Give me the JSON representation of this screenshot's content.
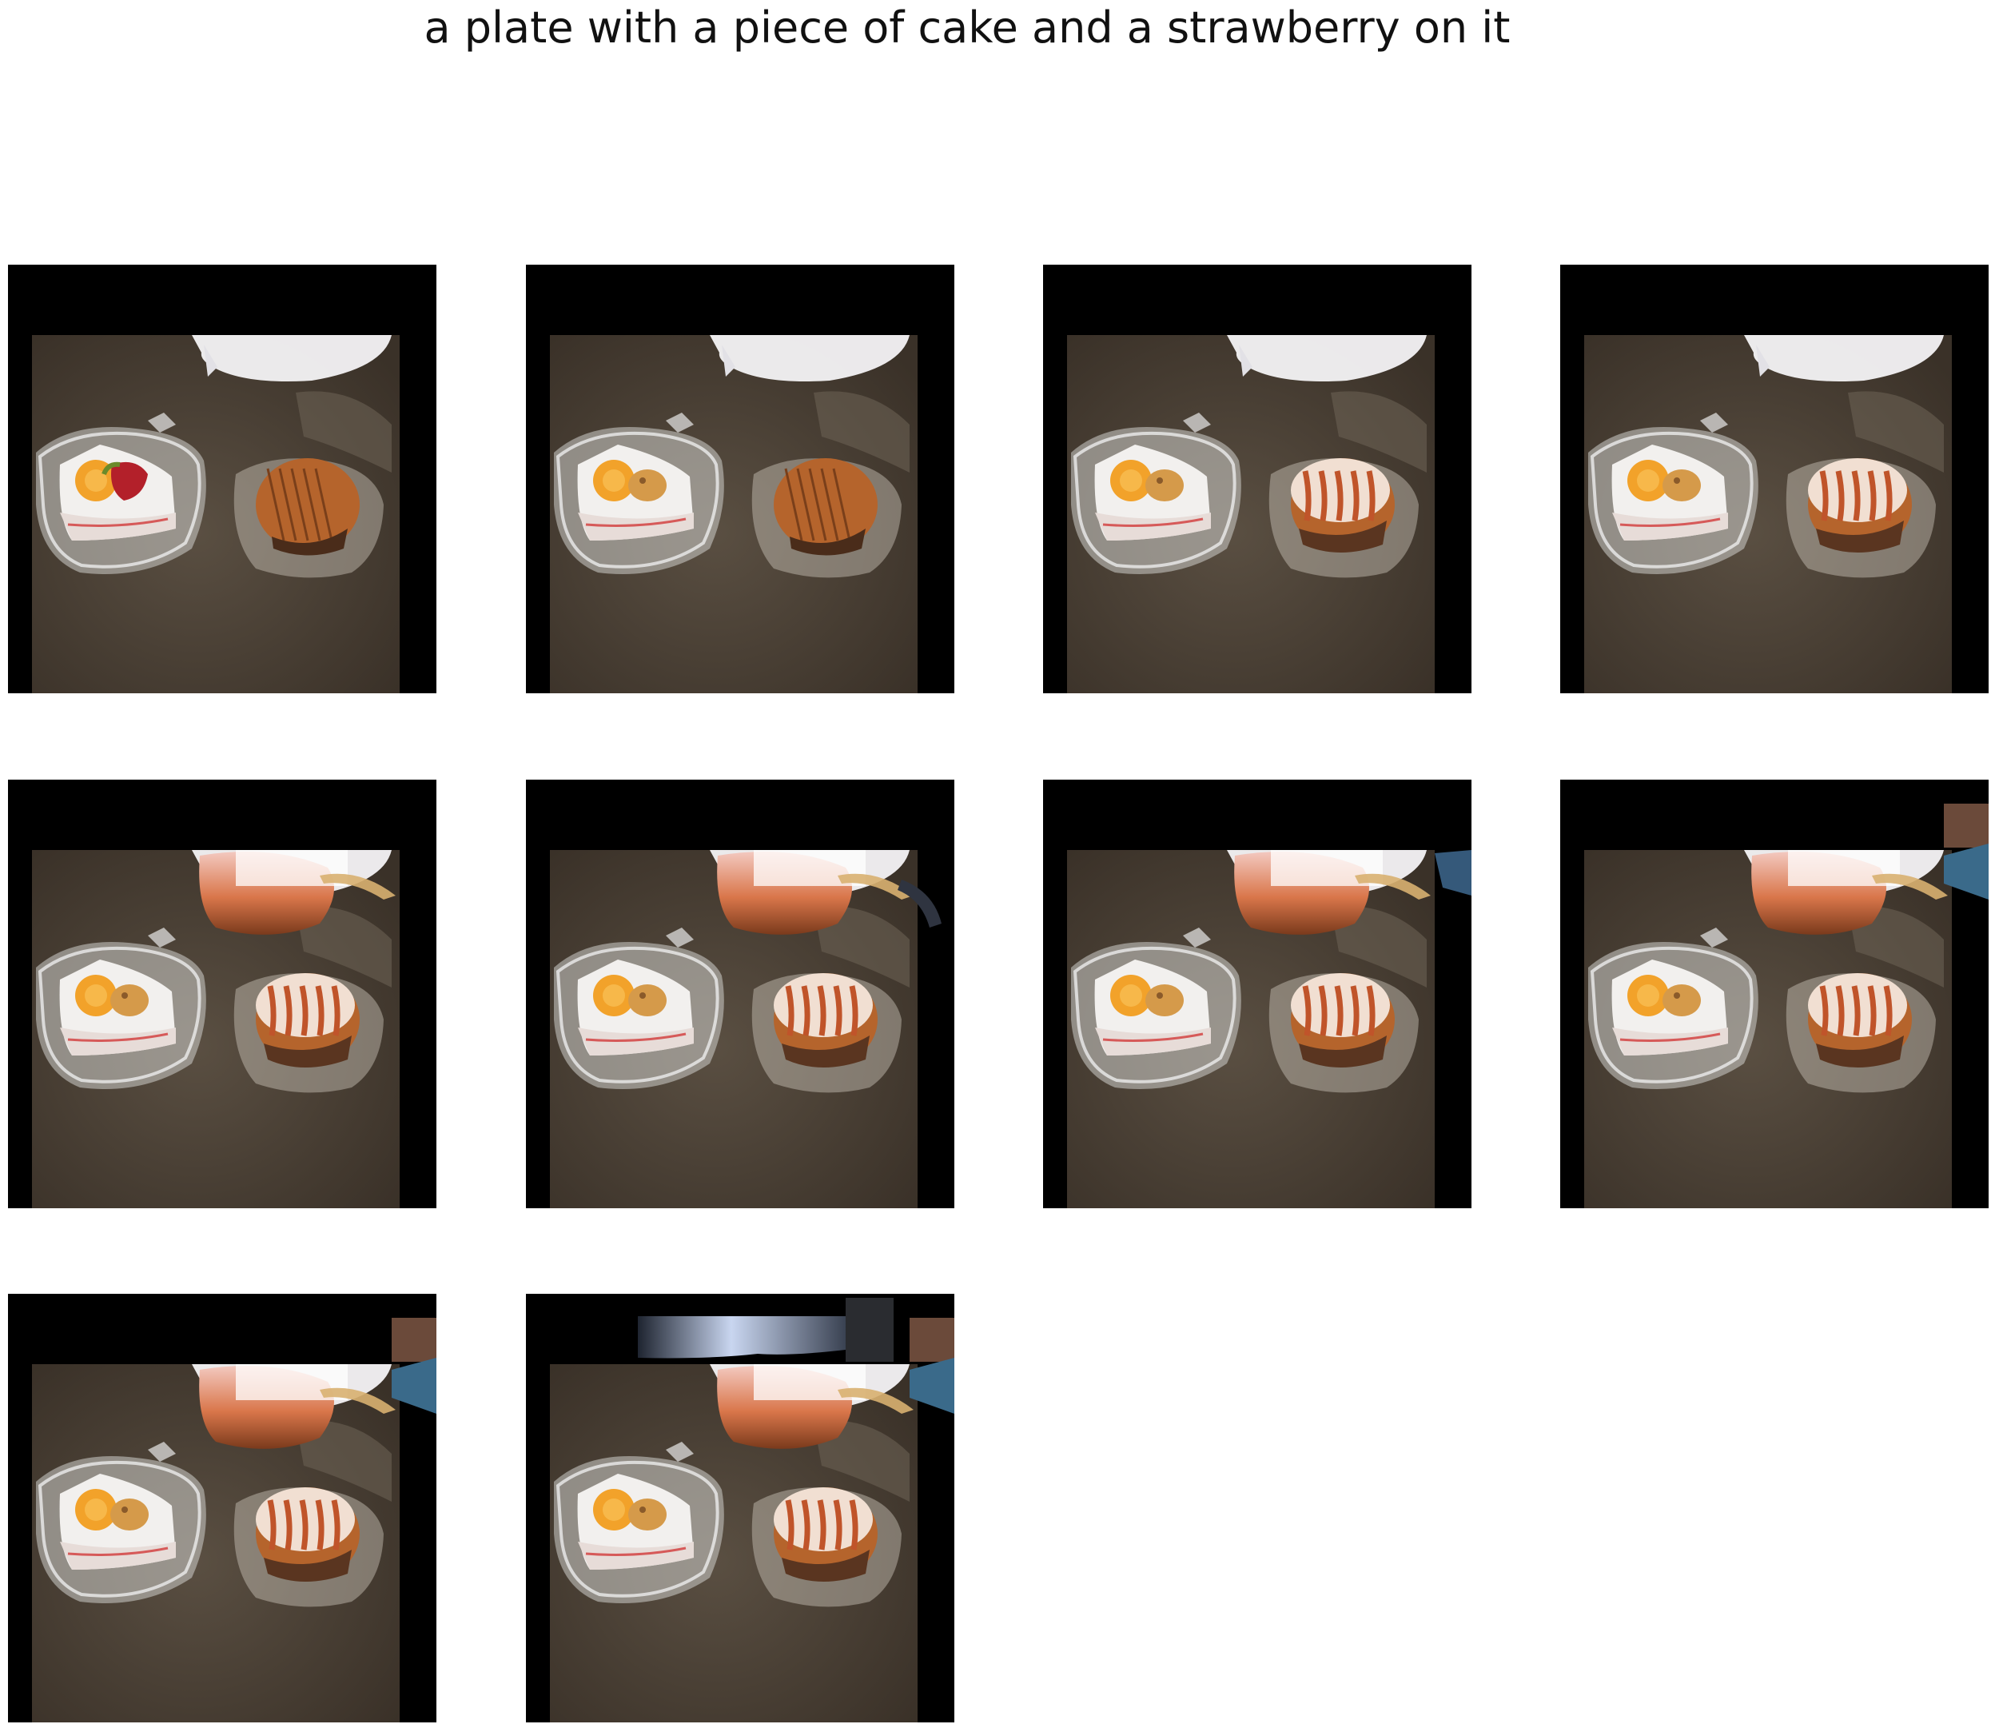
{
  "caption": "a plate with a piece of cake and a strawberry on it",
  "colors": {
    "background": "#ffffff",
    "padding": "#000000",
    "table": "#4a4034",
    "cream": "#f2f0ee",
    "orange": "#f2a22a",
    "strawberry": "#b3202a",
    "pastry": "#b5642c"
  },
  "panels": [
    {
      "id": 1,
      "strawberry": true,
      "pastry": "plain",
      "top_artifact": "none",
      "left_artifact": false
    },
    {
      "id": 2,
      "strawberry": false,
      "pastry": "plain",
      "top_artifact": "none",
      "left_artifact": false
    },
    {
      "id": 3,
      "strawberry": false,
      "pastry": "drizzle",
      "top_artifact": "none",
      "left_artifact": false
    },
    {
      "id": 4,
      "strawberry": false,
      "pastry": "drizzle",
      "top_artifact": "none",
      "left_artifact": false
    },
    {
      "id": 5,
      "strawberry": false,
      "pastry": "drizzle",
      "top_artifact": "dome",
      "left_artifact": false
    },
    {
      "id": 6,
      "strawberry": false,
      "pastry": "drizzle",
      "top_artifact": "dome",
      "left_artifact": false
    },
    {
      "id": 7,
      "strawberry": false,
      "pastry": "drizzle",
      "top_artifact": "dome",
      "left_artifact": false
    },
    {
      "id": 8,
      "strawberry": false,
      "pastry": "drizzle",
      "top_artifact": "dome",
      "left_artifact": true
    },
    {
      "id": 9,
      "strawberry": false,
      "pastry": "drizzle",
      "top_artifact": "dome",
      "left_artifact": true
    },
    {
      "id": 10,
      "strawberry": false,
      "pastry": "drizzle",
      "top_artifact": "banner",
      "left_artifact": true
    }
  ]
}
